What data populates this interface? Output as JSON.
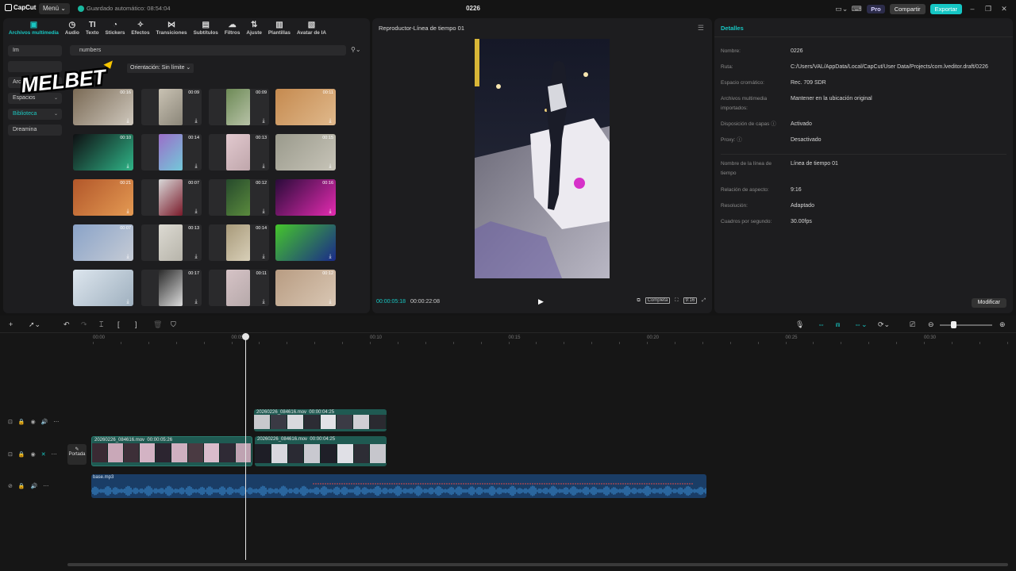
{
  "titlebar": {
    "app_name": "CapCut",
    "menu_label": "Menú ⌄",
    "autosave": "Guardado automático: 08:54:04",
    "project_title": "0226",
    "pro_label": "Pro",
    "share_label": "Compartir",
    "export_label": "Exportar"
  },
  "tabs": [
    {
      "label": "Archivos multimedia",
      "icon": "media-icon",
      "glyph": "▣",
      "active": true
    },
    {
      "label": "Audio",
      "icon": "audio-icon",
      "glyph": "◷"
    },
    {
      "label": "Texto",
      "icon": "text-icon",
      "glyph": "TI"
    },
    {
      "label": "Stickers",
      "icon": "sticker-icon",
      "glyph": "◔"
    },
    {
      "label": "Efectos",
      "icon": "effects-icon",
      "glyph": "✧"
    },
    {
      "label": "Transiciones",
      "icon": "transitions-icon",
      "glyph": "⋈"
    },
    {
      "label": "Subtítulos",
      "icon": "subtitles-icon",
      "glyph": "▤"
    },
    {
      "label": "Filtros",
      "icon": "filters-icon",
      "glyph": "☁"
    },
    {
      "label": "Ajuste",
      "icon": "adjust-icon",
      "glyph": "⇅"
    },
    {
      "label": "Plantillas",
      "icon": "templates-icon",
      "glyph": "▥"
    },
    {
      "label": "Avatar de IA",
      "icon": "avatar-icon",
      "glyph": "▧"
    }
  ],
  "sidebar": {
    "items": [
      {
        "label": "Im",
        "arrow": ""
      },
      {
        "label": "",
        "arrow": ""
      },
      {
        "label": "Archivos mu...",
        "arrow": "⌄"
      },
      {
        "label": "Espacios",
        "arrow": "⌄"
      },
      {
        "label": "Biblioteca",
        "arrow": "⌄",
        "active": true
      },
      {
        "label": "Dreamina",
        "arrow": ""
      }
    ]
  },
  "search": {
    "value": "numbers"
  },
  "orientation": "Orientación: Sin límite ⌄",
  "watermark": "MELBET",
  "media_grid": [
    {
      "duration": "00:16",
      "colors": [
        "#7a6a55",
        "#cfc8bd"
      ]
    },
    {
      "duration": "00:09",
      "colors": [
        "#c9c2b3",
        "#8b8679"
      ]
    },
    {
      "duration": "00:09",
      "colors": [
        "#6d8a56",
        "#b7c2a7"
      ]
    },
    {
      "duration": "00:11",
      "colors": [
        "#c58a4f",
        "#e0b98c"
      ]
    },
    {
      "duration": "00:10",
      "colors": [
        "#0f0f12",
        "#2fb487"
      ]
    },
    {
      "duration": "00:14",
      "colors": [
        "#9b6ec9",
        "#73c9d9"
      ]
    },
    {
      "duration": "00:13",
      "colors": [
        "#e2c9cf",
        "#bfa6ab"
      ]
    },
    {
      "duration": "00:15",
      "colors": [
        "#9a9a8c",
        "#c7c4b8"
      ]
    },
    {
      "duration": "00:21",
      "colors": [
        "#b2572a",
        "#e49a53"
      ]
    },
    {
      "duration": "00:07",
      "colors": [
        "#d8d8d8",
        "#7a1a2a"
      ]
    },
    {
      "duration": "00:12",
      "colors": [
        "#264a2c",
        "#5a8a3d"
      ]
    },
    {
      "duration": "00:16",
      "colors": [
        "#2a0b3a",
        "#e42bb0"
      ]
    },
    {
      "duration": "00:07",
      "colors": [
        "#8aa3c8",
        "#c5cbd5"
      ]
    },
    {
      "duration": "00:13",
      "colors": [
        "#dcdad2",
        "#b7b4aa"
      ]
    },
    {
      "duration": "00:14",
      "colors": [
        "#a89a7a",
        "#d8cfb8"
      ]
    },
    {
      "duration": "",
      "colors": [
        "#45c62b",
        "#1a2a8a"
      ]
    },
    {
      "duration": "",
      "colors": [
        "#dde6ee",
        "#9fb0bf"
      ]
    },
    {
      "duration": "00:17",
      "colors": [
        "#2a2a2a",
        "#dcdcdc"
      ]
    },
    {
      "duration": "00:11",
      "colors": [
        "#d6c3c6",
        "#b6a9aa"
      ]
    },
    {
      "duration": "00:12",
      "colors": [
        "#b89c82",
        "#d9c7b4"
      ]
    }
  ],
  "player": {
    "title": "Reproductor-Línea de tiempo 01",
    "current_time": "00:00:05:18",
    "total_time": "00:00:22:08",
    "complete_label": "Completa",
    "ratio_label": "9:16"
  },
  "details": {
    "title": "Detalles",
    "rows": [
      {
        "label": "Nombre:",
        "value": "0226"
      },
      {
        "label": "Ruta:",
        "value": "C:/Users/VAL/AppData/Local/CapCut/User Data/Projects/com.lveditor.draft/0226"
      },
      {
        "label": "Espacio cromático:",
        "value": "Rec. 709 SDR"
      },
      {
        "label": "Archivos multimedia importados:",
        "value": "Mantener en la ubicación original"
      },
      {
        "label": "Disposición de capas ⓘ",
        "value": "Activado"
      },
      {
        "label": "Proxy: ⓘ",
        "value": "Desactivado"
      },
      {
        "label": "Nombre de la línea de tiempo",
        "value": "Línea de tiempo 01"
      },
      {
        "label": "Relación de aspecto:",
        "value": "9:16"
      },
      {
        "label": "Resolución:",
        "value": "Adaptado"
      },
      {
        "label": "Cuadros por segundo:",
        "value": "30.00fps"
      }
    ],
    "modify_label": "Modificar"
  },
  "timeline": {
    "ruler": [
      "00:00",
      "00:05",
      "00:10",
      "00:15",
      "00:20",
      "00:25",
      "00:30"
    ],
    "portada_label": "Portada",
    "clips": {
      "overlay": {
        "name": "20260226_084616.mov",
        "duration": "00:00:04:25"
      },
      "main_a": {
        "name": "20260226_084616.mov",
        "duration": "00:00:05:26"
      },
      "main_b": {
        "name": "20260226_084616.mov",
        "duration": "00:00:04:25"
      },
      "audio": {
        "name": "base.mp3"
      }
    }
  },
  "colors": {
    "accent": "#18c7c3",
    "clip": "#1f5a52",
    "audio": "#1a3d66",
    "panel": "#1d1d1f"
  }
}
